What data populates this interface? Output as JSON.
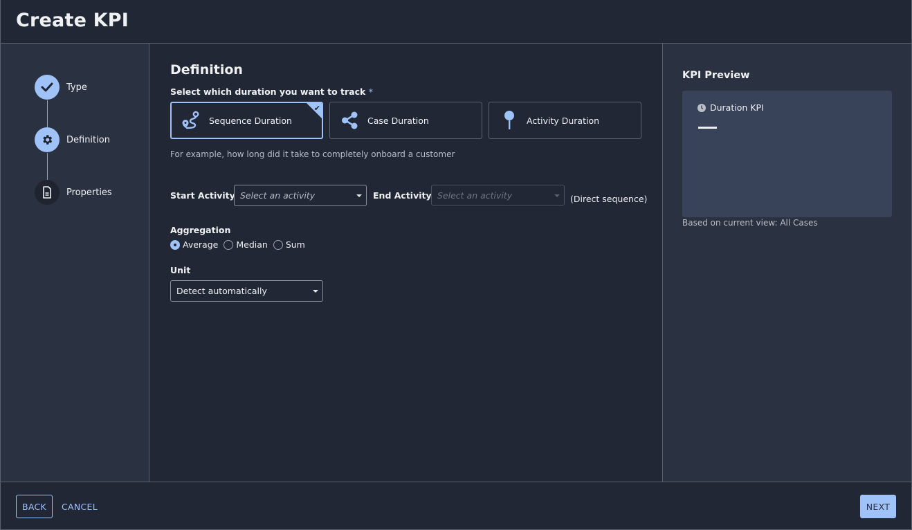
{
  "header": {
    "title": "Create KPI"
  },
  "stepper": {
    "steps": [
      {
        "label": "Type",
        "state": "completed",
        "icon": "check-icon"
      },
      {
        "label": "Definition",
        "state": "current",
        "icon": "gear-icon"
      },
      {
        "label": "Properties",
        "state": "pending",
        "icon": "document-icon"
      }
    ]
  },
  "definition": {
    "title": "Definition",
    "prompt": "Select which duration you want to track",
    "required_mark": "*",
    "options": [
      {
        "label": "Sequence Duration",
        "icon": "route-icon",
        "selected": true
      },
      {
        "label": "Case Duration",
        "icon": "share-icon",
        "selected": false
      },
      {
        "label": "Activity Duration",
        "icon": "pin-icon",
        "selected": false
      }
    ],
    "hint": "For example, how long did it take to completely onboard a customer",
    "start_activity": {
      "label": "Start Activity",
      "placeholder": "Select an activity"
    },
    "end_activity": {
      "label": "End Activity",
      "placeholder": "Select an activity",
      "disabled": true
    },
    "direct_sequence": "(Direct sequence)",
    "aggregation": {
      "label": "Aggregation",
      "options": [
        "Average",
        "Median",
        "Sum"
      ],
      "selected": "Average"
    },
    "unit": {
      "label": "Unit",
      "value": "Detect automatically"
    }
  },
  "preview": {
    "title": "KPI Preview",
    "kpi_name": "Duration KPI",
    "kpi_icon": "clock-icon",
    "value": "—",
    "basis": "Based on current view: All Cases"
  },
  "footer": {
    "back": "BACK",
    "cancel": "CANCEL",
    "next": "NEXT"
  },
  "colors": {
    "accent": "#9fc3f8",
    "background": "#212735",
    "panel": "#2a3241",
    "preview_card": "#384258"
  }
}
